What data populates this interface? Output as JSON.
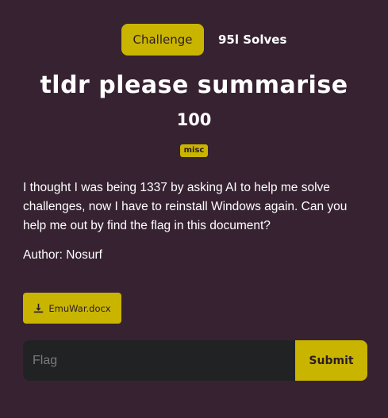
{
  "tabs": {
    "challenge_label": "Challenge",
    "solves_label": "95l Solves"
  },
  "challenge": {
    "title": "tldr please summarise",
    "points": "100",
    "tag": "misc",
    "description": "I thought I was being 1337 by asking AI to help me solve challenges, now I have to reinstall Windows again. Can you help me out by find the flag in this document?",
    "author": "Author: Nosurf"
  },
  "file": {
    "name": "EmuWar.docx",
    "icon": "download-icon"
  },
  "form": {
    "flag_placeholder": "Flag",
    "flag_value": "",
    "submit_label": "Submit"
  },
  "colors": {
    "background": "#372232",
    "accent": "#c9b400",
    "input_background": "#212224"
  }
}
